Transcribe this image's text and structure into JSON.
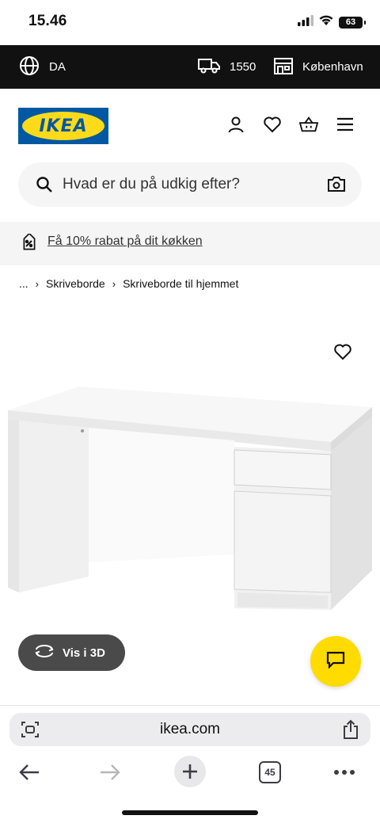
{
  "status": {
    "time": "15.46",
    "battery": "63"
  },
  "top_bar": {
    "language": "DA",
    "delivery_postcode": "1550",
    "store": "København"
  },
  "header": {
    "logo_text": "IKEA"
  },
  "search": {
    "placeholder": "Hvad er du på udkig efter?"
  },
  "promo": {
    "text": "Få 10% rabat på dit køkken"
  },
  "breadcrumb": {
    "items": [
      "...",
      "Skriveborde",
      "Skriveborde til hjemmet"
    ]
  },
  "product": {
    "view_3d_label": "Vis i 3D"
  },
  "browser": {
    "url": "ikea.com",
    "tab_count": "45"
  },
  "colors": {
    "ikea_blue": "#0058a3",
    "ikea_yellow": "#ffda1a",
    "chat_yellow": "#ffdb00",
    "top_bar": "#111111"
  }
}
